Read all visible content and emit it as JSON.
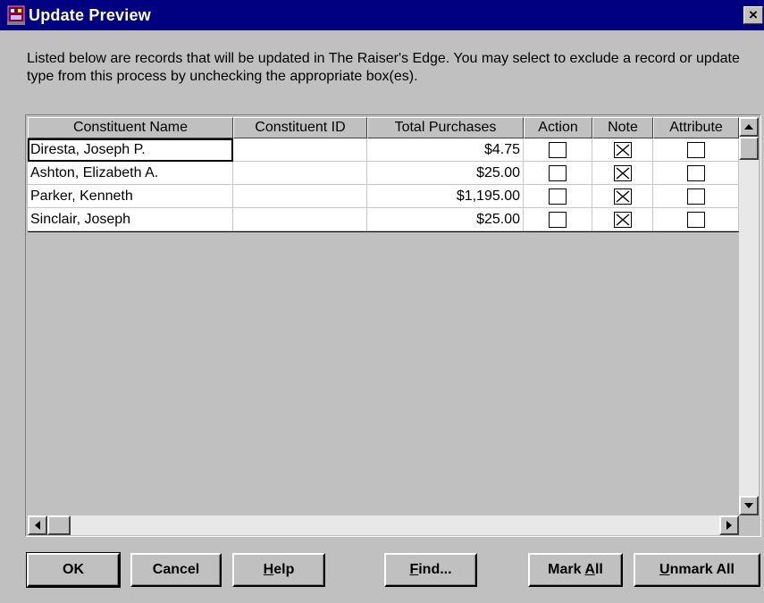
{
  "window": {
    "title": "Update Preview",
    "close_label": "×"
  },
  "description": "Listed below are records that will be updated in The Raiser's Edge.  You may select to exclude a record or update type from this process by unchecking the appropriate box(es).",
  "grid": {
    "columns": [
      "Constituent Name",
      "Constituent ID",
      "Total Purchases",
      "Action",
      "Note",
      "Attribute"
    ],
    "rows": [
      {
        "name": "Diresta, Joseph P.",
        "id": "",
        "total": "$4.75",
        "action": false,
        "note": true,
        "attribute": false
      },
      {
        "name": "Ashton, Elizabeth A.",
        "id": "",
        "total": "$25.00",
        "action": false,
        "note": true,
        "attribute": false
      },
      {
        "name": "Parker, Kenneth",
        "id": "",
        "total": "$1,195.00",
        "action": false,
        "note": true,
        "attribute": false
      },
      {
        "name": "Sinclair, Joseph",
        "id": "",
        "total": "$25.00",
        "action": false,
        "note": true,
        "attribute": false
      }
    ]
  },
  "buttons": {
    "ok": "OK",
    "cancel": "Cancel",
    "help": {
      "mnemonic": "H",
      "rest": "elp"
    },
    "find": {
      "mnemonic": "F",
      "rest": "ind..."
    },
    "mark_all": {
      "prefix": "Mark ",
      "mnemonic": "A",
      "rest": "ll"
    },
    "unmark_all": {
      "mnemonic": "U",
      "rest": "nmark All"
    }
  },
  "icons": {
    "app": "raisers-edge-app-icon",
    "close": "close-icon",
    "scroll_up": "scroll-up-arrow-icon",
    "scroll_down": "scroll-down-arrow-icon",
    "scroll_left": "scroll-left-arrow-icon",
    "scroll_right": "scroll-right-arrow-icon",
    "checkbox": "checkbox-icon"
  },
  "colors": {
    "titlebar": "#000080",
    "dialog": "#c0c0c0",
    "grid_background": "#ffffff"
  }
}
